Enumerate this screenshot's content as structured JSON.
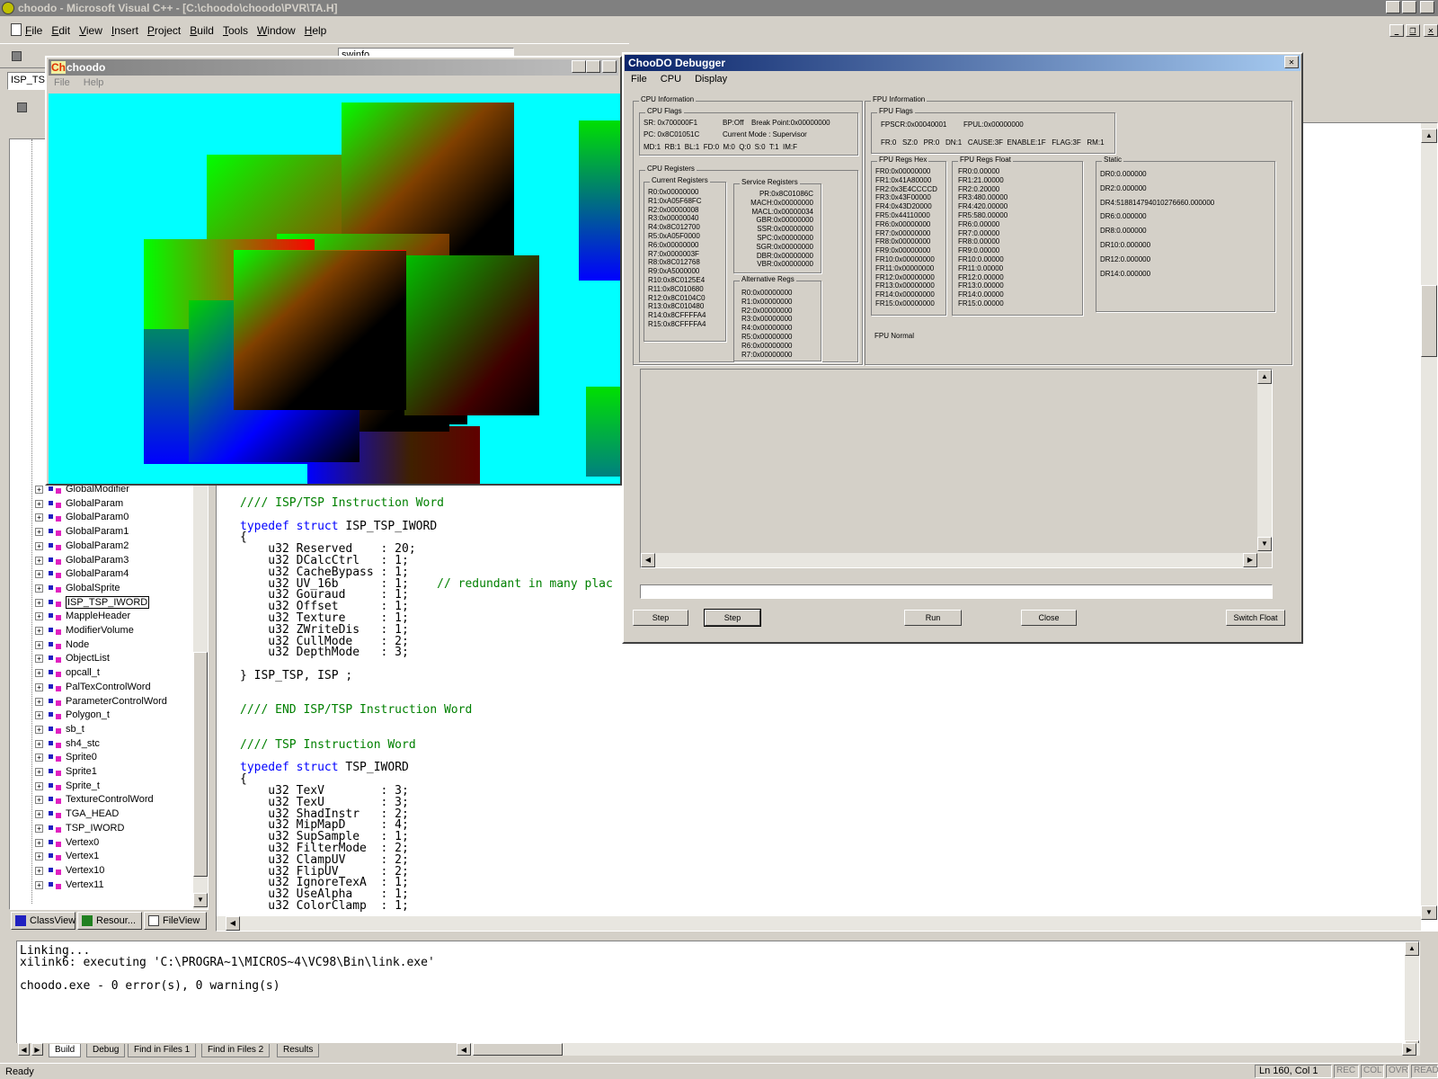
{
  "app": {
    "title": "choodo - Microsoft Visual C++ - [C:\\choodo\\choodo\\PVR\\TA.H]",
    "menu": [
      "File",
      "Edit",
      "View",
      "Insert",
      "Project",
      "Build",
      "Tools",
      "Window",
      "Help"
    ],
    "toolbar_combo_value": "swinfo",
    "class_combo_value": "ISP_TS"
  },
  "choodo_window": {
    "title_prefix": "Ch",
    "title": "choodo",
    "menu": [
      "File",
      "Help"
    ]
  },
  "tree": {
    "items": [
      "GlobalModifier",
      "GlobalParam",
      "GlobalParam0",
      "GlobalParam1",
      "GlobalParam2",
      "GlobalParam3",
      "GlobalParam4",
      "GlobalSprite",
      "ISP_TSP_IWORD",
      "MappleHeader",
      "ModifierVolume",
      "Node",
      "ObjectList",
      "opcall_t",
      "PalTexControlWord",
      "ParameterControlWord",
      "Polygon_t",
      "sb_t",
      "sh4_stc",
      "Sprite0",
      "Sprite1",
      "Sprite_t",
      "TextureControlWord",
      "TGA_HEAD",
      "TSP_IWORD",
      "Vertex0",
      "Vertex1",
      "Vertex10",
      "Vertex11"
    ],
    "selected": "ISP_TSP_IWORD",
    "tabs": [
      "ClassView",
      "Resour...",
      "FileView"
    ]
  },
  "code": {
    "lines": [
      {
        "t": "//// ISP/TSP Instruction Word",
        "c": "cmt"
      },
      {
        "t": "",
        "c": ""
      },
      {
        "t": "typedef struct ISP_TSP_IWORD",
        "c": "td"
      },
      {
        "t": "{",
        "c": ""
      },
      {
        "t": "    u32 Reserved    : 20;",
        "c": ""
      },
      {
        "t": "    u32 DCalcCtrl   : 1;",
        "c": ""
      },
      {
        "t": "    u32 CacheBypass : 1;",
        "c": ""
      },
      {
        "t": "    u32 UV_16b      : 1;    // redundant in many plac",
        "c": "mix"
      },
      {
        "t": "    u32 Gouraud     : 1;",
        "c": ""
      },
      {
        "t": "    u32 Offset      : 1;",
        "c": ""
      },
      {
        "t": "    u32 Texture     : 1;",
        "c": ""
      },
      {
        "t": "    u32 ZWriteDis   : 1;",
        "c": ""
      },
      {
        "t": "    u32 CullMode    : 2;",
        "c": ""
      },
      {
        "t": "    u32 DepthMode   : 3;",
        "c": ""
      },
      {
        "t": "",
        "c": ""
      },
      {
        "t": "} ISP_TSP, ISP ;",
        "c": ""
      },
      {
        "t": "",
        "c": ""
      },
      {
        "t": "",
        "c": ""
      },
      {
        "t": "//// END ISP/TSP Instruction Word",
        "c": "cmt"
      },
      {
        "t": "",
        "c": ""
      },
      {
        "t": "",
        "c": ""
      },
      {
        "t": "//// TSP Instruction Word",
        "c": "cmt"
      },
      {
        "t": "",
        "c": ""
      },
      {
        "t": "typedef struct TSP_IWORD",
        "c": "td"
      },
      {
        "t": "{",
        "c": ""
      },
      {
        "t": "    u32 TexV        : 3;",
        "c": ""
      },
      {
        "t": "    u32 TexU        : 3;",
        "c": ""
      },
      {
        "t": "    u32 ShadInstr   : 2;",
        "c": ""
      },
      {
        "t": "    u32 MipMapD     : 4;",
        "c": ""
      },
      {
        "t": "    u32 SupSample   : 1;",
        "c": ""
      },
      {
        "t": "    u32 FilterMode  : 2;",
        "c": ""
      },
      {
        "t": "    u32 ClampUV     : 2;",
        "c": ""
      },
      {
        "t": "    u32 FlipUV      : 2;",
        "c": ""
      },
      {
        "t": "    u32 IgnoreTexA  : 1;",
        "c": ""
      },
      {
        "t": "    u32 UseAlpha    : 1;",
        "c": ""
      },
      {
        "t": "    u32 ColorClamp  : 1;",
        "c": ""
      }
    ]
  },
  "debugger": {
    "title": "ChooDO Debugger",
    "menu": [
      "File",
      "CPU",
      "Display"
    ],
    "cpu_info_label": "CPU Information",
    "cpu_flags_label": "CPU Flags",
    "cpu_flags": [
      "SR: 0x700000F1",
      "BP:Off",
      "Break Point:0x00000000",
      "PC: 0x8C01051C",
      "Current Mode : Supervisor",
      "MD:1  RB:1  BL:1  FD:0  M:0  Q:0  S:0  T:1  IM:F"
    ],
    "cpu_registers_label": "CPU Registers",
    "current_registers_label": "Current Registers",
    "current_registers": [
      "R0:0x00000000",
      "R1:0xA05F68FC",
      "R2:0x00000008",
      "R3:0x00000040",
      "R4:0x8C012700",
      "R5:0xA05F0000",
      "R6:0x00000000",
      "R7:0x0000003F",
      "R8:0x8C012768",
      "R9:0xA5000000",
      "R10:0x8C0125E4",
      "R11:0x8C010680",
      "R12:0x8C0104C0",
      "R13:0x8C010480",
      "R14:0x8CFFFFA4",
      "R15:0x8CFFFFA4"
    ],
    "service_registers_label": "Service Registers",
    "service_registers": [
      "PR:0x8C01086C",
      "MACH:0x00000000",
      "MACL:0x00000034",
      "GBR:0x00000000",
      "SSR:0x00000000",
      "SPC:0x00000000",
      "SGR:0x00000000",
      "DBR:0x00000000",
      "VBR:0x00000000"
    ],
    "alt_registers_label": "Alternative Regs",
    "alt_registers": [
      "R0:0x00000000",
      "R1:0x00000000",
      "R2:0x00000000",
      "R3:0x00000000",
      "R4:0x00000000",
      "R5:0x00000000",
      "R6:0x00000000",
      "R7:0x00000000"
    ],
    "fpu_info_label": "FPU Information",
    "fpu_flags_label": "FPU Flags",
    "fpu_flags": [
      "FPSCR:0x00040001",
      "FPUL:0x00000000",
      "FR:0   SZ:0   PR:0   DN:1   CAUSE:3F  ENABLE:1F   FLAG:3F   RM:1"
    ],
    "fpu_hex_label": "FPU Regs Hex",
    "fpu_hex": [
      "FR0:0x00000000",
      "FR1:0x41A80000",
      "FR2:0x3E4CCCCD",
      "FR3:0x43F00000",
      "FR4:0x43D20000",
      "FR5:0x44110000",
      "FR6:0x00000000",
      "FR7:0x00000000",
      "FR8:0x00000000",
      "FR9:0x00000000",
      "FR10:0x00000000",
      "FR11:0x00000000",
      "FR12:0x00000000",
      "FR13:0x00000000",
      "FR14:0x00000000",
      "FR15:0x00000000"
    ],
    "fpu_float_label": "FPU Regs Float",
    "fpu_float": [
      "FR0:0.00000",
      "FR1:21.00000",
      "FR2:0.20000",
      "FR3:480.00000",
      "FR4:420.00000",
      "FR5:580.00000",
      "FR6:0.00000",
      "FR7:0.00000",
      "FR8:0.00000",
      "FR9:0.00000",
      "FR10:0.00000",
      "FR11:0.00000",
      "FR12:0.00000",
      "FR13:0.00000",
      "FR14:0.00000",
      "FR15:0.00000"
    ],
    "static_label": "Static",
    "static_regs": [
      "DR0:0.000000",
      "DR2:0.000000",
      "DR4:518814794010276660.000000",
      "DR6:0.000000",
      "DR8:0.000000",
      "DR10:0.000000",
      "DR12:0.000000",
      "DR14:0.000000"
    ],
    "fpu_mode": "FPU Normal",
    "buttons": {
      "step1": "Step",
      "step2": "Step",
      "run": "Run",
      "close": "Close",
      "switch": "Switch Float"
    }
  },
  "output": {
    "lines": [
      "Linking...",
      "xilink6: executing 'C:\\PROGRA~1\\MICROS~4\\VC98\\Bin\\link.exe'",
      "",
      "choodo.exe - 0 error(s), 0 warning(s)"
    ],
    "tabs": [
      "Build",
      "Debug",
      "Find in Files 1",
      "Find in Files 2",
      "Results"
    ]
  },
  "status": {
    "text": "Ready",
    "position": "Ln 160, Col 1",
    "indicators": [
      "REC",
      "COL",
      "OVR",
      "READ"
    ]
  }
}
